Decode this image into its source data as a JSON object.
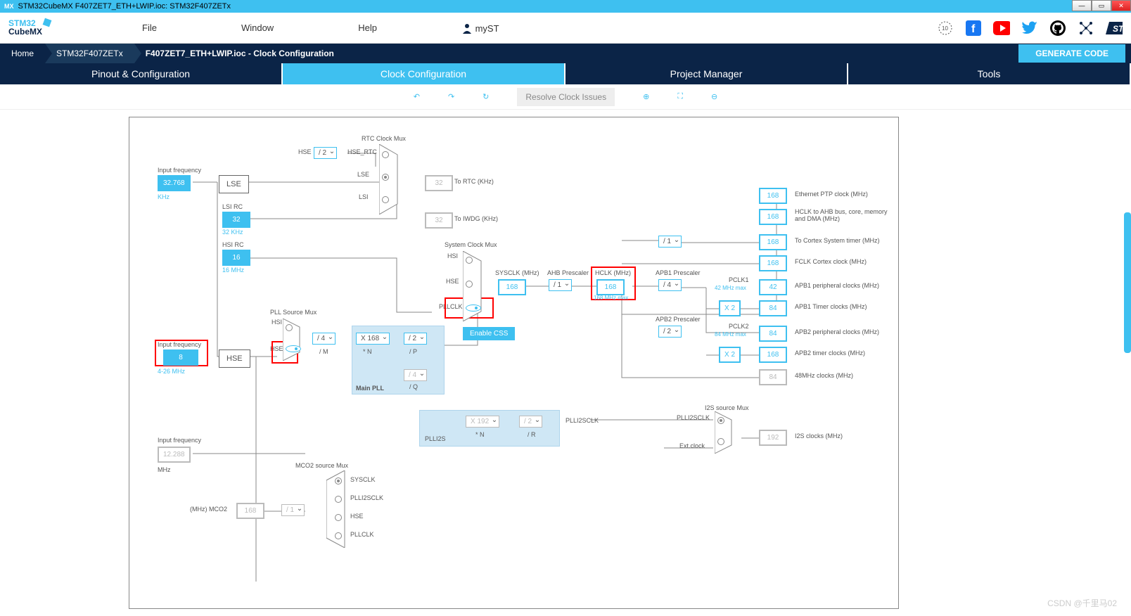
{
  "title": "STM32CubeMX F407ZET7_ETH+LWIP.ioc: STM32F407ZETx",
  "menu": {
    "file": "File",
    "window": "Window",
    "help": "Help",
    "myst": "myST"
  },
  "breadcrumb": {
    "home": "Home",
    "chip": "STM32F407ZETx",
    "proj": "F407ZET7_ETH+LWIP.ioc - Clock Configuration",
    "gen": "GENERATE CODE"
  },
  "tabs": {
    "pinout": "Pinout & Configuration",
    "clock": "Clock Configuration",
    "proj": "Project Manager",
    "tools": "Tools"
  },
  "toolbar": {
    "resolve": "Resolve Clock Issues"
  },
  "clock": {
    "lse_freq_label": "Input frequency",
    "lse_freq": "32.768",
    "lse_unit": "KHz",
    "lse": "LSE",
    "lsi_label": "LSI RC",
    "lsi": "32",
    "lsi_unit": "32 KHz",
    "hsi_label": "HSI RC",
    "hsi": "16",
    "hsi_unit": "16 MHz",
    "hse_freq_label": "Input frequency",
    "hse_freq": "8",
    "hse_unit": "4-26 MHz",
    "hse": "HSE",
    "i2s_freq_label": "Input frequency",
    "i2s_freq": "12.288",
    "i2s_unit": "MHz",
    "rtc_mux": "RTC Clock Mux",
    "rtc_div": "/ 2",
    "rtc_out": "32",
    "rtc_out_label": "To RTC (KHz)",
    "iwdg": "32",
    "iwdg_label": "To IWDG (KHz)",
    "sys_mux": "System Clock Mux",
    "sys_hsi": "HSI",
    "sys_hse": "HSE",
    "sys_pll": "PLLCLK",
    "sys_css": "Enable CSS",
    "sysclk_label": "SYSCLK (MHz)",
    "sysclk": "168",
    "ahb_label": "AHB Prescaler",
    "ahb": "/ 1",
    "hclk_label": "HCLK (MHz)",
    "hclk": "168",
    "hclk_max": "168 MHz max",
    "apb1_label": "APB1 Prescaler",
    "apb1": "/ 4",
    "pclk1_label": "PCLK1",
    "pclk1_max": "42 MHz max",
    "apb1_peri": "42",
    "apb1_tim_x": "X 2",
    "apb1_tim": "84",
    "apb2_label": "APB2 Prescaler",
    "apb2": "/ 2",
    "pclk2_label": "PCLK2",
    "pclk2_max": "84 MHz max",
    "apb2_peri": "84",
    "apb2_tim_x": "X 2",
    "apb2_tim": "168",
    "cortex_div": "/ 1",
    "cortex": "168",
    "cortex_label": "To Cortex System timer (MHz)",
    "eth": "168",
    "eth_label": "Ethernet PTP clock (MHz)",
    "ahb_bus": "168",
    "ahb_bus_label": "HCLK to AHB bus, core, memory and DMA (MHz)",
    "fclk": "168",
    "fclk_label": "FCLK Cortex clock (MHz)",
    "apb1_peri_label": "APB1 peripheral clocks (MHz)",
    "apb1_tim_label": "APB1 Timer clocks (MHz)",
    "apb2_peri_label": "APB2 peripheral clocks (MHz)",
    "apb2_tim_label": "APB2 timer clocks (MHz)",
    "clk48": "84",
    "clk48_label": "48MHz clocks (MHz)",
    "pll_src": "PLL Source Mux",
    "pll_hsi": "HSI",
    "pll_hse": "HSE",
    "pll_m": "/ 4",
    "pll_m_label": "/ M",
    "pll_n": "X 168",
    "pll_n_label": "* N",
    "pll_p": "/ 2",
    "pll_p_label": "/ P",
    "pll_q": "/ 4",
    "pll_q_label": "/ Q",
    "pll_main": "Main PLL",
    "plli2s": "PLLI2S",
    "plli2s_n": "X 192",
    "plli2s_n_label": "* N",
    "plli2s_r": "/ 2",
    "plli2s_r_label": "/ R",
    "plli2sclk": "PLLI2SCLK",
    "i2s_mux": "I2S source Mux",
    "i2s_ext": "Ext.clock",
    "i2s_out": "192",
    "i2s_out_label": "I2S clocks (MHz)",
    "plli2sclk2": "PLLI2SCLK",
    "mco2": "MCO2 source Mux",
    "mco2_out": "168",
    "mco2_div": "/ 1",
    "mco2_label": "(MHz) MCO2",
    "mco2_sysclk": "SYSCLK",
    "mco2_plli2s": "PLLI2SCLK",
    "mco2_hse": "HSE",
    "mco2_pll": "PLLCLK",
    "hse_rtc": "HSE_RTC",
    "lse_sig": "LSE",
    "lsi_sig": "LSI",
    "hse_sig": "HSE"
  },
  "watermark": "CSDN @千里马02"
}
